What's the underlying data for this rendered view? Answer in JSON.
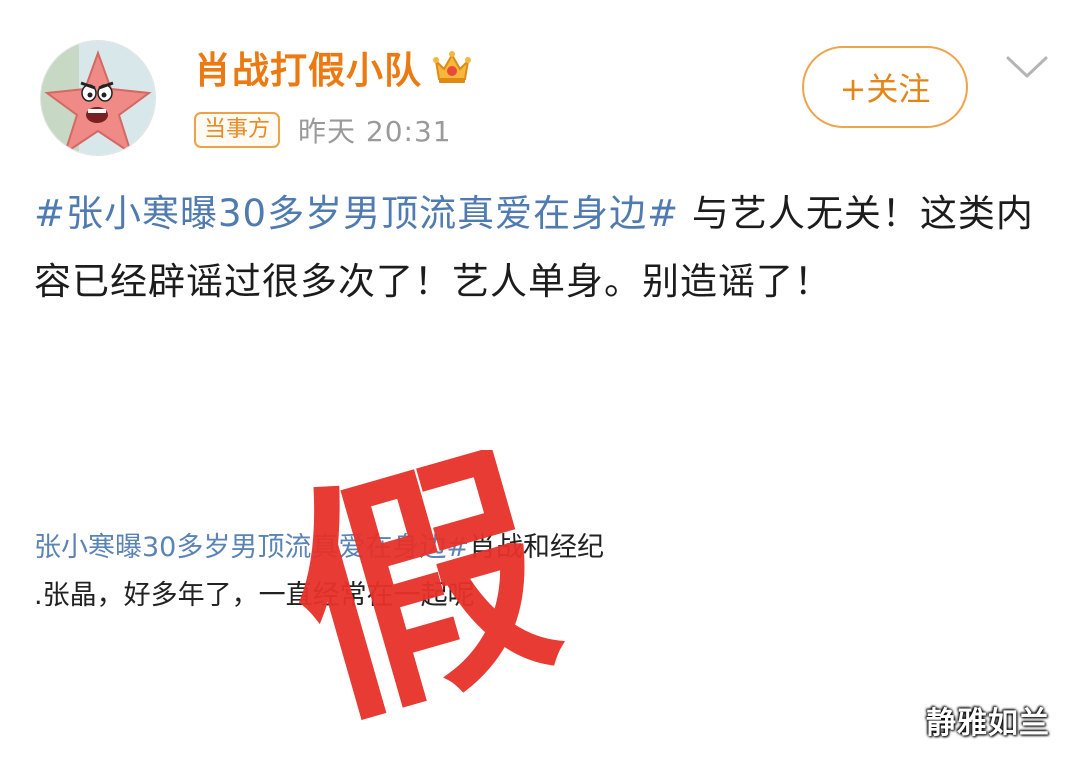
{
  "post": {
    "username": "肖战打假小队",
    "badge": "当事方",
    "time": "昨天 20:31",
    "follow_label": "+关注",
    "hashtag": "#张小寒曝30多岁男顶流真爱在身边#",
    "body_text": " 与艺人无关！这类内容已经辟谣过很多次了！艺人单身。别造谣了！"
  },
  "excerpt": {
    "hashtag": "张小寒曝30多岁男顶流真爱在身边#",
    "line1_rest": "肖战和经纪",
    "line2": ".张晶，好多年了，一直经常在一起呢"
  },
  "stamp": {
    "text": "假",
    "color": "#e6312a"
  },
  "watermark": "静雅如兰",
  "icons": {
    "avatar": "patrick-star-avatar",
    "crown": "crown-icon",
    "more": "chevron-down-icon"
  },
  "colors": {
    "accent": "#ec7a12",
    "link": "#4f7bb0",
    "stamp_red": "#e6312a"
  }
}
